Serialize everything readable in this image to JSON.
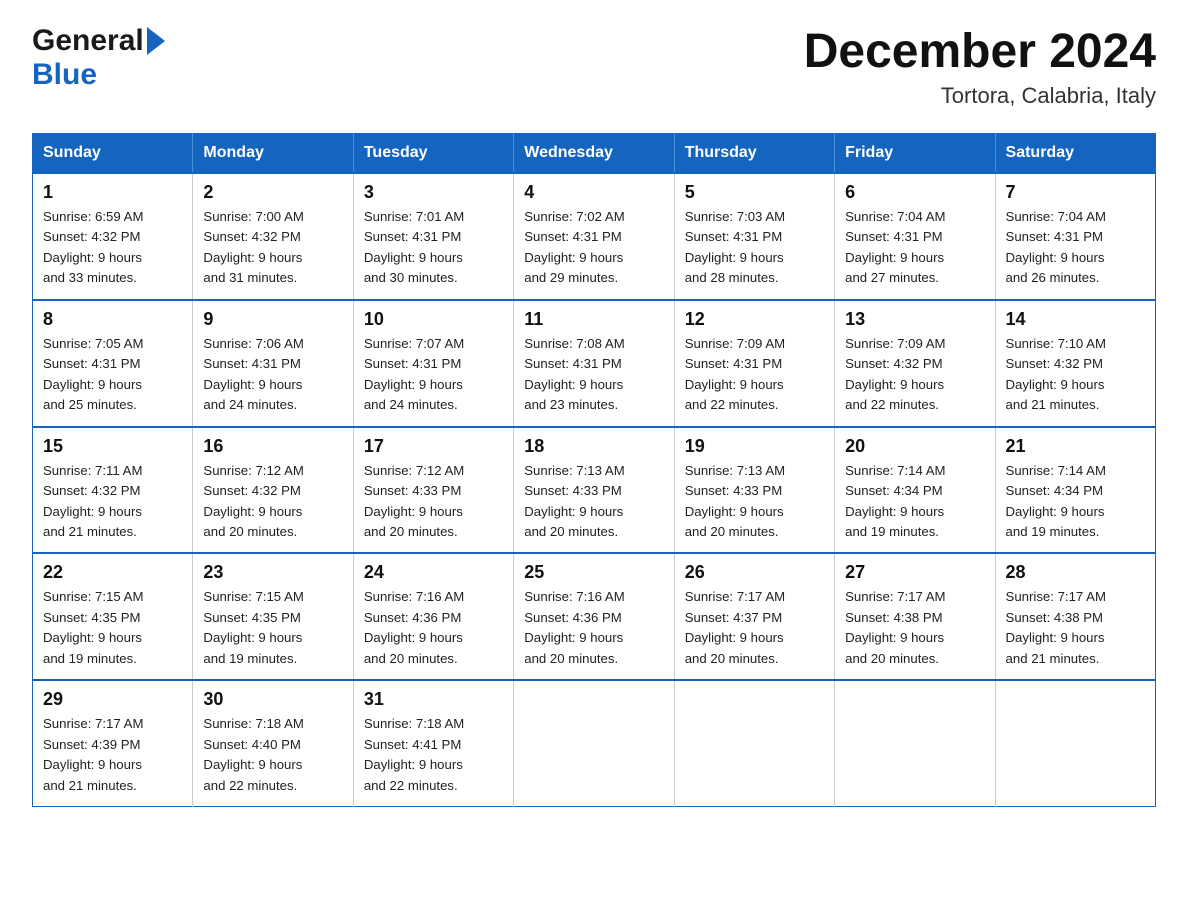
{
  "logo": {
    "general": "General",
    "blue": "Blue"
  },
  "title": "December 2024",
  "subtitle": "Tortora, Calabria, Italy",
  "days": [
    "Sunday",
    "Monday",
    "Tuesday",
    "Wednesday",
    "Thursday",
    "Friday",
    "Saturday"
  ],
  "weeks": [
    [
      {
        "day": "1",
        "sunrise": "6:59 AM",
        "sunset": "4:32 PM",
        "daylight": "9 hours and 33 minutes."
      },
      {
        "day": "2",
        "sunrise": "7:00 AM",
        "sunset": "4:32 PM",
        "daylight": "9 hours and 31 minutes."
      },
      {
        "day": "3",
        "sunrise": "7:01 AM",
        "sunset": "4:31 PM",
        "daylight": "9 hours and 30 minutes."
      },
      {
        "day": "4",
        "sunrise": "7:02 AM",
        "sunset": "4:31 PM",
        "daylight": "9 hours and 29 minutes."
      },
      {
        "day": "5",
        "sunrise": "7:03 AM",
        "sunset": "4:31 PM",
        "daylight": "9 hours and 28 minutes."
      },
      {
        "day": "6",
        "sunrise": "7:04 AM",
        "sunset": "4:31 PM",
        "daylight": "9 hours and 27 minutes."
      },
      {
        "day": "7",
        "sunrise": "7:04 AM",
        "sunset": "4:31 PM",
        "daylight": "9 hours and 26 minutes."
      }
    ],
    [
      {
        "day": "8",
        "sunrise": "7:05 AM",
        "sunset": "4:31 PM",
        "daylight": "9 hours and 25 minutes."
      },
      {
        "day": "9",
        "sunrise": "7:06 AM",
        "sunset": "4:31 PM",
        "daylight": "9 hours and 24 minutes."
      },
      {
        "day": "10",
        "sunrise": "7:07 AM",
        "sunset": "4:31 PM",
        "daylight": "9 hours and 24 minutes."
      },
      {
        "day": "11",
        "sunrise": "7:08 AM",
        "sunset": "4:31 PM",
        "daylight": "9 hours and 23 minutes."
      },
      {
        "day": "12",
        "sunrise": "7:09 AM",
        "sunset": "4:31 PM",
        "daylight": "9 hours and 22 minutes."
      },
      {
        "day": "13",
        "sunrise": "7:09 AM",
        "sunset": "4:32 PM",
        "daylight": "9 hours and 22 minutes."
      },
      {
        "day": "14",
        "sunrise": "7:10 AM",
        "sunset": "4:32 PM",
        "daylight": "9 hours and 21 minutes."
      }
    ],
    [
      {
        "day": "15",
        "sunrise": "7:11 AM",
        "sunset": "4:32 PM",
        "daylight": "9 hours and 21 minutes."
      },
      {
        "day": "16",
        "sunrise": "7:12 AM",
        "sunset": "4:32 PM",
        "daylight": "9 hours and 20 minutes."
      },
      {
        "day": "17",
        "sunrise": "7:12 AM",
        "sunset": "4:33 PM",
        "daylight": "9 hours and 20 minutes."
      },
      {
        "day": "18",
        "sunrise": "7:13 AM",
        "sunset": "4:33 PM",
        "daylight": "9 hours and 20 minutes."
      },
      {
        "day": "19",
        "sunrise": "7:13 AM",
        "sunset": "4:33 PM",
        "daylight": "9 hours and 20 minutes."
      },
      {
        "day": "20",
        "sunrise": "7:14 AM",
        "sunset": "4:34 PM",
        "daylight": "9 hours and 19 minutes."
      },
      {
        "day": "21",
        "sunrise": "7:14 AM",
        "sunset": "4:34 PM",
        "daylight": "9 hours and 19 minutes."
      }
    ],
    [
      {
        "day": "22",
        "sunrise": "7:15 AM",
        "sunset": "4:35 PM",
        "daylight": "9 hours and 19 minutes."
      },
      {
        "day": "23",
        "sunrise": "7:15 AM",
        "sunset": "4:35 PM",
        "daylight": "9 hours and 19 minutes."
      },
      {
        "day": "24",
        "sunrise": "7:16 AM",
        "sunset": "4:36 PM",
        "daylight": "9 hours and 20 minutes."
      },
      {
        "day": "25",
        "sunrise": "7:16 AM",
        "sunset": "4:36 PM",
        "daylight": "9 hours and 20 minutes."
      },
      {
        "day": "26",
        "sunrise": "7:17 AM",
        "sunset": "4:37 PM",
        "daylight": "9 hours and 20 minutes."
      },
      {
        "day": "27",
        "sunrise": "7:17 AM",
        "sunset": "4:38 PM",
        "daylight": "9 hours and 20 minutes."
      },
      {
        "day": "28",
        "sunrise": "7:17 AM",
        "sunset": "4:38 PM",
        "daylight": "9 hours and 21 minutes."
      }
    ],
    [
      {
        "day": "29",
        "sunrise": "7:17 AM",
        "sunset": "4:39 PM",
        "daylight": "9 hours and 21 minutes."
      },
      {
        "day": "30",
        "sunrise": "7:18 AM",
        "sunset": "4:40 PM",
        "daylight": "9 hours and 22 minutes."
      },
      {
        "day": "31",
        "sunrise": "7:18 AM",
        "sunset": "4:41 PM",
        "daylight": "9 hours and 22 minutes."
      },
      null,
      null,
      null,
      null
    ]
  ],
  "labels": {
    "sunrise": "Sunrise:",
    "sunset": "Sunset:",
    "daylight": "Daylight:"
  }
}
